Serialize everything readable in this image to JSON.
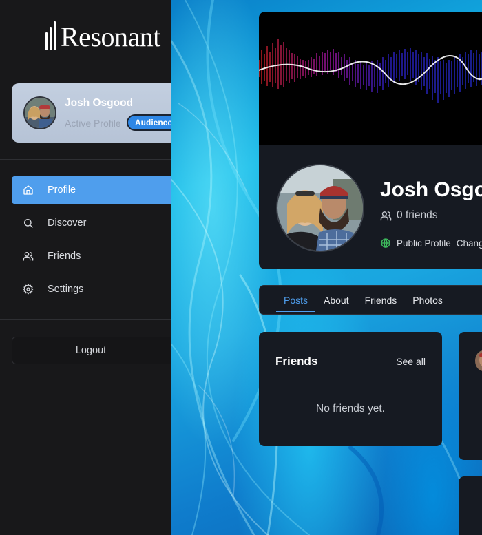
{
  "app": {
    "name": "Resonant"
  },
  "sidebar": {
    "profile": {
      "name": "Josh Osgood",
      "status": "Active Profile",
      "badge": "Audience"
    },
    "nav": [
      {
        "label": "Profile",
        "icon": "home-icon",
        "active": true
      },
      {
        "label": "Discover",
        "icon": "search-icon",
        "active": false
      },
      {
        "label": "Friends",
        "icon": "users-icon",
        "active": false
      },
      {
        "label": "Settings",
        "icon": "gear-icon",
        "active": false
      }
    ],
    "logout_label": "Logout"
  },
  "header": {
    "name": "Josh Osgood",
    "friends_count": "0 friends",
    "visibility": "Public Profile",
    "change_label": "Change"
  },
  "tabs": [
    {
      "label": "Posts",
      "active": true
    },
    {
      "label": "About",
      "active": false
    },
    {
      "label": "Friends",
      "active": false
    },
    {
      "label": "Photos",
      "active": false
    }
  ],
  "friends_panel": {
    "title": "Friends",
    "see_all": "See all",
    "empty": "No friends yet."
  },
  "colors": {
    "accent": "#4f9eed",
    "badge": "#2e87e6",
    "public_icon": "#3fbf5f"
  }
}
